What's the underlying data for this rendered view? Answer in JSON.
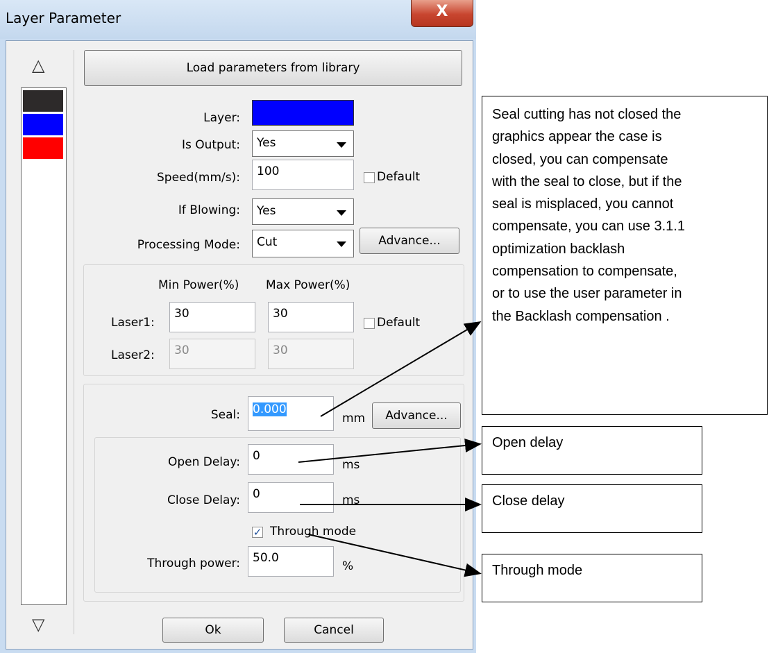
{
  "window": {
    "title": "Layer Parameter",
    "close_glyph": "X"
  },
  "layer_list": {
    "up_arrow": "△",
    "down_arrow": "▽",
    "colors": [
      "#2d2a2a",
      "#0000ff",
      "#ff0000"
    ]
  },
  "load_button": "Load parameters from library",
  "layer": {
    "label": "Layer:",
    "color": "#0000ff"
  },
  "is_output": {
    "label": "Is Output:",
    "value": "Yes"
  },
  "speed": {
    "label": "Speed(mm/s):",
    "value": "100",
    "default_label": "Default"
  },
  "if_blowing": {
    "label": "If Blowing:",
    "value": "Yes"
  },
  "processing_mode": {
    "label": "Processing Mode:",
    "value": "Cut",
    "advance": "Advance..."
  },
  "power": {
    "min_header": "Min Power(%)",
    "max_header": "Max Power(%)",
    "laser1": {
      "label": "Laser1:",
      "min": "30",
      "max": "30"
    },
    "laser2": {
      "label": "Laser2:",
      "min": "30",
      "max": "30"
    },
    "default_label": "Default"
  },
  "seal": {
    "label": "Seal:",
    "value": "0.000",
    "unit": "mm",
    "advance": "Advance..."
  },
  "open_delay": {
    "label": "Open Delay:",
    "value": "0",
    "unit": "ms"
  },
  "close_delay": {
    "label": "Close Delay:",
    "value": "0",
    "unit": "ms"
  },
  "through_mode": {
    "label": "Through mode",
    "checked": true
  },
  "through_power": {
    "label": "Through power:",
    "value": "50.0",
    "unit": "%"
  },
  "footer": {
    "ok": "Ok",
    "cancel": "Cancel"
  },
  "annotations": {
    "seal_note_lines": [
      "Seal cutting has not closed the",
      "graphics appear the case is",
      "closed, you can compensate",
      "with the seal to close, but if the",
      "seal is misplaced, you cannot",
      "compensate, you can use 3.1.1",
      "optimization backlash",
      "compensation to compensate,",
      "or to use the user parameter in",
      "the Backlash compensation ."
    ],
    "open_delay_note": "Open delay",
    "close_delay_note": "Close delay",
    "through_mode_note": "Through mode"
  }
}
